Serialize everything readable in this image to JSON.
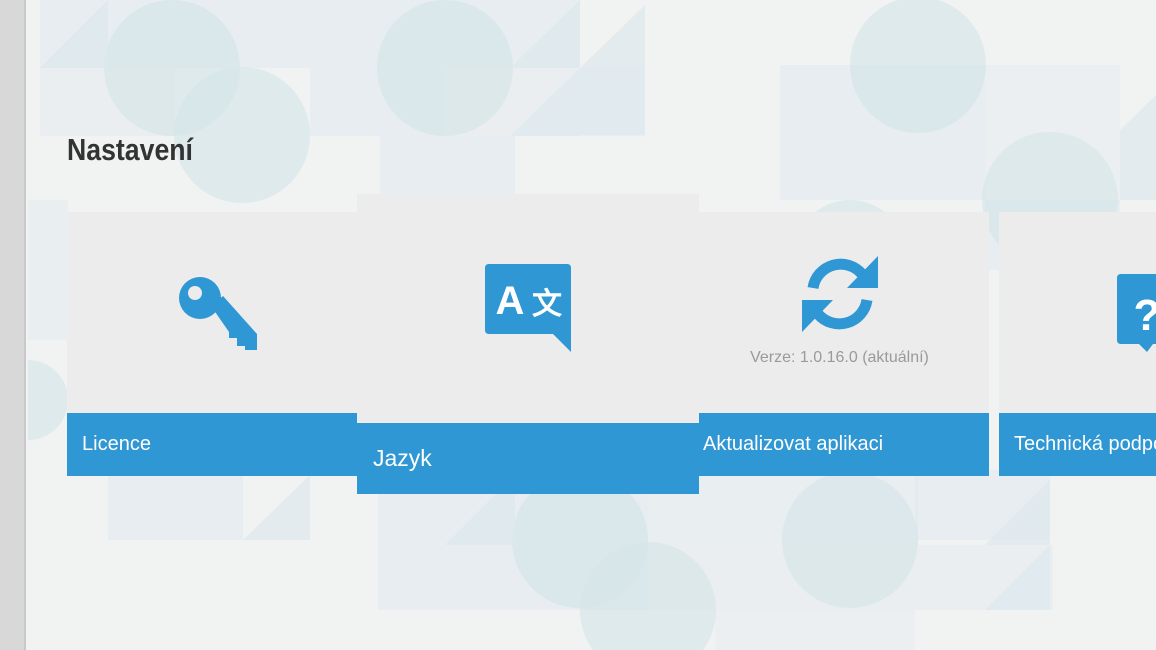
{
  "page": {
    "title": "Nastavení"
  },
  "tiles": [
    {
      "label": "Licence",
      "icon": "key-icon"
    },
    {
      "label": "Jazyk",
      "icon": "translate-icon",
      "focused": true
    },
    {
      "label": "Aktualizovat aplikaci",
      "icon": "refresh-icon",
      "note": "Verze: 1.0.16.0 (aktuální)"
    },
    {
      "label": "Technická podpora",
      "icon": "help-chat-icon"
    }
  ],
  "colors": {
    "accent": "#2f97d3",
    "tile_body": "#ececec",
    "background": "#f1f2f2",
    "title_text": "#333333",
    "note_text": "#9a9a9a"
  }
}
